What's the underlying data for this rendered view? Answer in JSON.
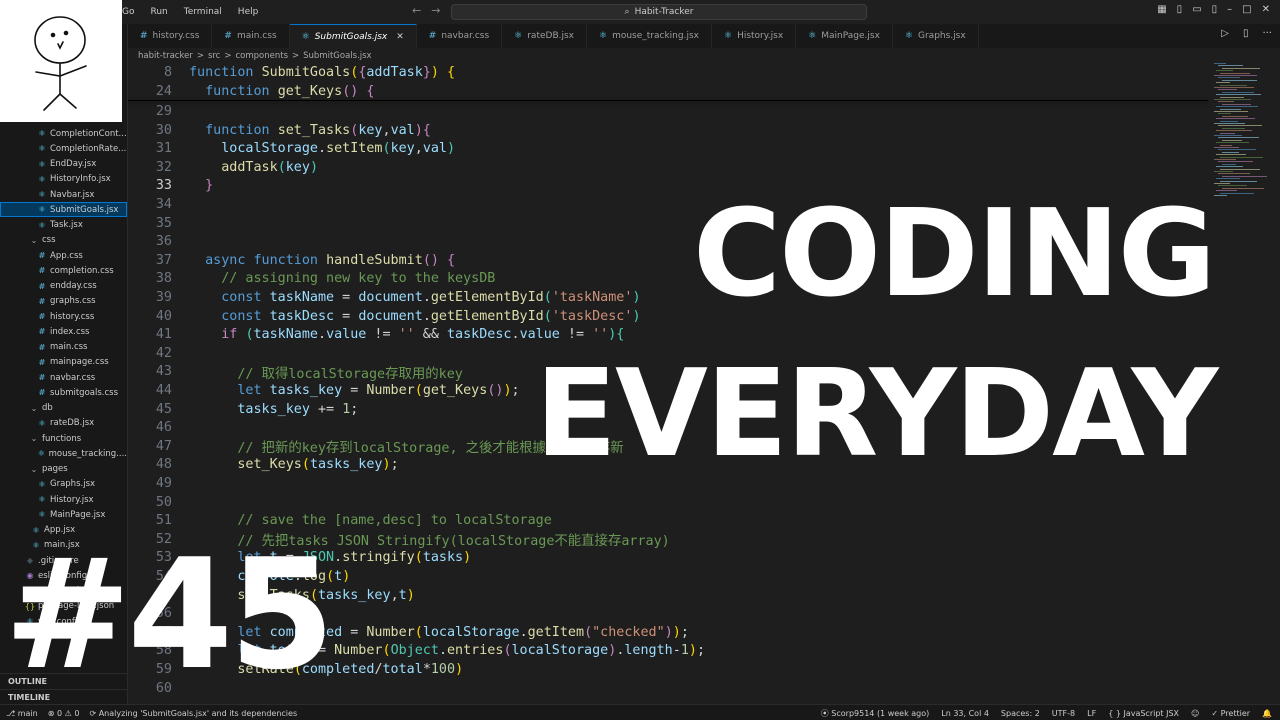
{
  "menu": [
    "Go",
    "Run",
    "Terminal",
    "Help"
  ],
  "command_center": "Habit-Tracker",
  "tabs": [
    {
      "label": "history.css",
      "active": false
    },
    {
      "label": "main.css",
      "active": false
    },
    {
      "label": "SubmitGoals.jsx",
      "active": true
    },
    {
      "label": "navbar.css",
      "active": false
    },
    {
      "label": "rateDB.jsx",
      "active": false
    },
    {
      "label": "mouse_tracking.jsx",
      "active": false
    },
    {
      "label": "History.jsx",
      "active": false
    },
    {
      "label": "MainPage.jsx",
      "active": false
    },
    {
      "label": "Graphs.jsx",
      "active": false
    }
  ],
  "breadcrumb": [
    "habit-tracker",
    ">",
    "src",
    ">",
    "components",
    ">",
    "SubmitGoals.jsx"
  ],
  "explorer": [
    "CompletionCont...",
    "CompletionRate...",
    "EndDay.jsx",
    "HistoryInfo.jsx",
    "Navbar.jsx",
    "SubmitGoals.jsx",
    "Task.jsx",
    "css",
    "App.css",
    "completion.css",
    "endday.css",
    "graphs.css",
    "history.css",
    "index.css",
    "main.css",
    "mainpage.css",
    "navbar.css",
    "submitgoals.css",
    "db",
    "rateDB.jsx",
    "functions",
    "mouse_tracking....",
    "pages",
    "Graphs.jsx",
    "History.jsx",
    "MainPage.jsx",
    "App.jsx",
    "main.jsx",
    ".gitignore",
    "eslintconfig",
    "package.json",
    "package-lock.json",
    "vite.config.js"
  ],
  "panels": {
    "outline": "OUTLINE",
    "timeline": "TIMELINE"
  },
  "code": {
    "sticky": [
      {
        "n": "8",
        "html": "<span class='k'>function</span> <span class='f'>SubmitGoals</span><span class='p'>(</span><span class='kc'>{</span><span class='v'>addTask</span><span class='kc'>}</span><span class='p'>)</span> <span class='p'>{</span>"
      },
      {
        "n": "24",
        "html": "  <span class='k'>function</span> <span class='f'>get_Keys</span><span class='kc'>()</span> <span class='kc'>{</span>"
      }
    ],
    "lines": [
      {
        "n": "29",
        "html": ""
      },
      {
        "n": "30",
        "html": "  <span class='k'>function</span> <span class='f'>set_Tasks</span><span class='kc'>(</span><span class='v'>key</span>,<span class='v'>val</span><span class='kc'>){</span>"
      },
      {
        "n": "31",
        "html": "    <span class='v'>localStorage</span>.<span class='f'>setItem</span><span class='t'>(</span><span class='v'>key</span>,<span class='v'>val</span><span class='t'>)</span>"
      },
      {
        "n": "32",
        "html": "    <span class='f'>addTask</span><span class='t'>(</span><span class='v'>key</span><span class='t'>)</span>"
      },
      {
        "n": "33",
        "html": "  <span class='kc'>}</span>",
        "current": true
      },
      {
        "n": "34",
        "html": ""
      },
      {
        "n": "35",
        "html": ""
      },
      {
        "n": "36",
        "html": ""
      },
      {
        "n": "37",
        "html": "  <span class='k'>async</span> <span class='k'>function</span> <span class='f'>handleSubmit</span><span class='kc'>()</span> <span class='kc'>{</span>"
      },
      {
        "n": "38",
        "html": "    <span class='c'>// assigning new key to the keysDB</span>"
      },
      {
        "n": "39",
        "html": "    <span class='k'>const</span> <span class='v'>taskName</span> = <span class='v'>document</span>.<span class='f'>getElementById</span><span class='t'>(</span><span class='s'>'taskName'</span><span class='t'>)</span>"
      },
      {
        "n": "40",
        "html": "    <span class='k'>const</span> <span class='v'>taskDesc</span> = <span class='v'>document</span>.<span class='f'>getElementById</span><span class='t'>(</span><span class='s'>'taskDesc'</span><span class='t'>)</span>"
      },
      {
        "n": "41",
        "html": "    <span class='kc'>if</span> <span class='t'>(</span><span class='v'>taskName</span>.<span class='v'>value</span> != <span class='s'>''</span> &amp;&amp; <span class='v'>taskDesc</span>.<span class='v'>value</span> != <span class='s'>''</span><span class='t'>){</span>"
      },
      {
        "n": "42",
        "html": ""
      },
      {
        "n": "43",
        "html": "      <span class='c'>// 取得localStorage存取用的key</span>"
      },
      {
        "n": "44",
        "html": "      <span class='k'>let</span> <span class='v'>tasks_key</span> = <span class='f'>Number</span><span class='p'>(</span><span class='f'>get_Keys</span><span class='kc'>()</span><span class='p'>)</span>;"
      },
      {
        "n": "45",
        "html": "      <span class='v'>tasks_key</span> += <span class='n'>1</span>;"
      },
      {
        "n": "46",
        "html": ""
      },
      {
        "n": "47",
        "html": "      <span class='c'>// 把新的key存到localStorage, 之後才能根據這個key存新</span>"
      },
      {
        "n": "48",
        "html": "      <span class='f'>set_Keys</span><span class='p'>(</span><span class='v'>tasks_key</span><span class='p'>)</span>;"
      },
      {
        "n": "49",
        "html": ""
      },
      {
        "n": "50",
        "html": ""
      },
      {
        "n": "51",
        "html": "      <span class='c'>// save the [name,desc] to localStorage</span>"
      },
      {
        "n": "52",
        "html": "      <span class='c'>// 先把tasks JSON Stringify(localStorage不能直接存array)</span>"
      },
      {
        "n": "53",
        "html": "      <span class='k'>let</span> <span class='v'>t</span> = <span class='t'>JSON</span>.<span class='f'>stringify</span><span class='p'>(</span><span class='v'>tasks</span><span class='p'>)</span>"
      },
      {
        "n": "54",
        "html": "      <span class='v'>console</span>.<span class='f'>log</span><span class='p'>(</span><span class='v'>t</span><span class='p'>)</span>"
      },
      {
        "n": "55",
        "html": "      <span class='f'>set_Tasks</span><span class='p'>(</span><span class='v'>tasks_key</span>,<span class='v'>t</span><span class='p'>)</span>"
      },
      {
        "n": "56",
        "html": ""
      },
      {
        "n": "57",
        "html": "      <span class='k'>let</span> <span class='v'>completed</span> = <span class='f'>Number</span><span class='p'>(</span><span class='v'>localStorage</span>.<span class='f'>getItem</span><span class='kc'>(</span><span class='s'>\"checked\"</span><span class='kc'>)</span><span class='p'>)</span>;"
      },
      {
        "n": "58",
        "html": "      <span class='k'>let</span> <span class='v'>total</span> = <span class='f'>Number</span><span class='p'>(</span><span class='t'>Object</span>.<span class='f'>entries</span><span class='kc'>(</span><span class='v'>localStorage</span><span class='kc'>)</span>.<span class='v'>length</span>-<span class='n'>1</span><span class='p'>)</span>;"
      },
      {
        "n": "59",
        "html": "      <span class='f'>setRate</span><span class='p'>(</span><span class='v'>completed</span>/<span class='v'>total</span>*<span class='n'>100</span><span class='p'>)</span>"
      },
      {
        "n": "60",
        "html": ""
      }
    ]
  },
  "overlay": {
    "line1": "CODING",
    "line2": "EVERYDAY",
    "episode": "#45"
  },
  "status": {
    "branch": "main",
    "problems": "⊗ 0  ⚠ 0",
    "analyzing": "Analyzing 'SubmitGoals.jsx' and its dependencies",
    "blame": "Scorp9514 (1 week ago)",
    "position": "Ln 33, Col 4",
    "spaces": "Spaces: 2",
    "encoding": "UTF-8",
    "eol": "LF",
    "language": "JavaScript JSX",
    "prettier": "✓ Prettier"
  }
}
